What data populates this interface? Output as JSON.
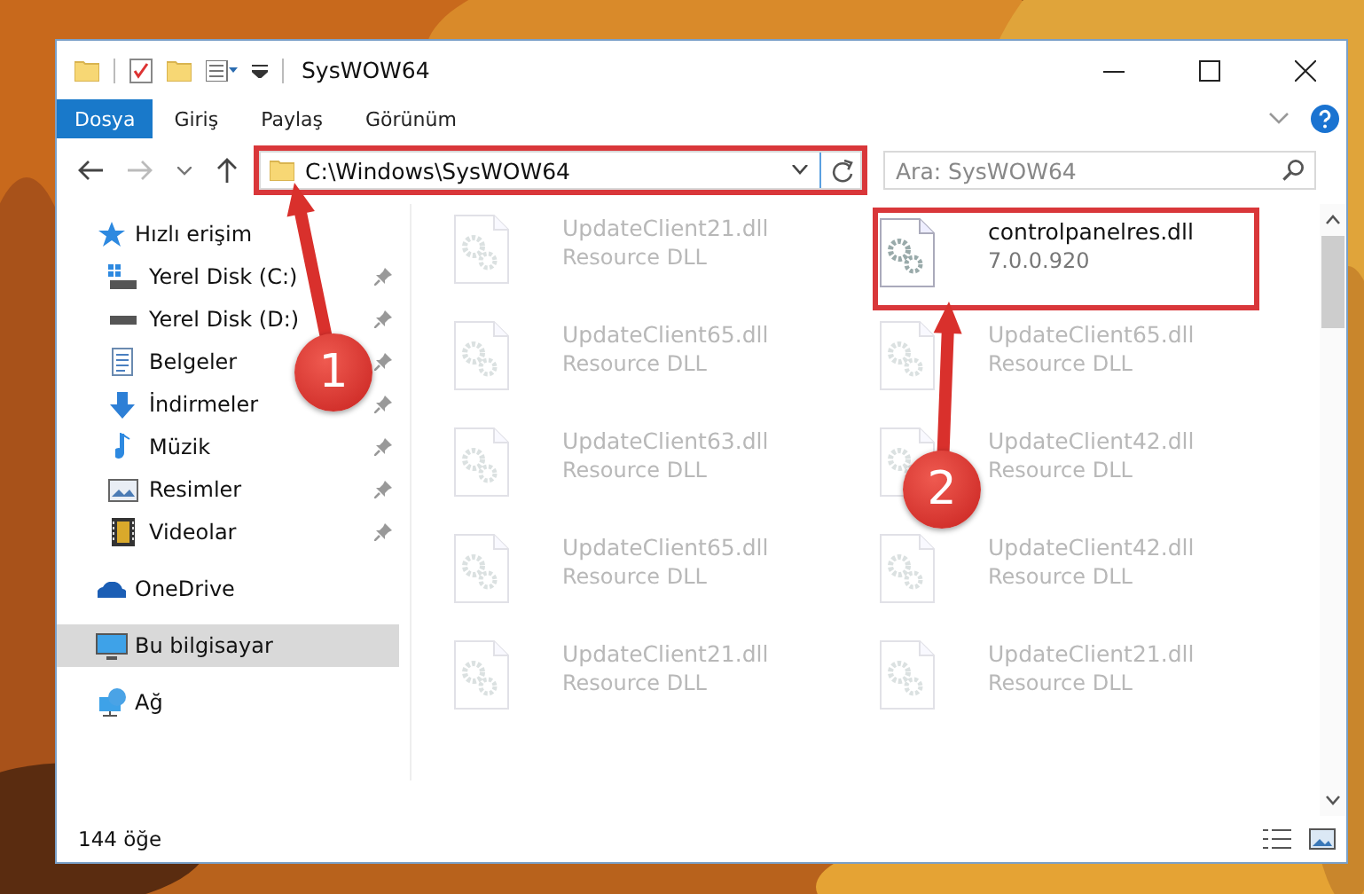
{
  "window": {
    "title": "SysWOW64"
  },
  "ribbon_tabs": [
    {
      "label": "Dosya",
      "selected": true
    },
    {
      "label": "Giriş",
      "selected": false
    },
    {
      "label": "Paylaş",
      "selected": false
    },
    {
      "label": "Görünüm",
      "selected": false
    }
  ],
  "address": {
    "value": "C:\\Windows\\SysWOW64",
    "highlighted": true
  },
  "search": {
    "placeholder": "Ara: SysWOW64"
  },
  "sidebar": {
    "items": [
      {
        "label": "Hızlı erişim",
        "kind": "star",
        "selected": false,
        "children": [
          {
            "label": "Yerel Disk (C:)",
            "kind": "systemdrive",
            "selected": false,
            "pinned": true
          },
          {
            "label": "Yerel Disk (D:)",
            "kind": "drive",
            "selected": false,
            "pinned": true
          },
          {
            "label": "Belgeler",
            "kind": "documents",
            "selected": false,
            "pinned": true
          },
          {
            "label": "İndirmeler",
            "kind": "downloads",
            "selected": false,
            "pinned": true
          },
          {
            "label": "Müzik",
            "kind": "music",
            "selected": false,
            "pinned": true
          },
          {
            "label": "Resimler",
            "kind": "pictures",
            "selected": false,
            "pinned": true
          },
          {
            "label": "Videolar",
            "kind": "videos",
            "selected": false,
            "pinned": true
          }
        ]
      },
      {
        "label": "OneDrive",
        "kind": "cloud",
        "selected": false
      },
      {
        "label": "Bu bilgisayar",
        "kind": "computer",
        "selected": true
      },
      {
        "label": "Ağ",
        "kind": "network",
        "selected": false
      }
    ]
  },
  "files": [
    {
      "name": "UpdateClient21.dll",
      "detail": "Resource DLL",
      "faded": true,
      "highlighted": false
    },
    {
      "name": "controlpanelres.dll",
      "detail": "7.0.0.920",
      "faded": false,
      "highlighted": true
    },
    {
      "name": "UpdateClient65.dll",
      "detail": "Resource DLL",
      "faded": true,
      "highlighted": false
    },
    {
      "name": "UpdateClient65.dll",
      "detail": "Resource DLL",
      "faded": true,
      "highlighted": false
    },
    {
      "name": "UpdateClient63.dll",
      "detail": "Resource DLL",
      "faded": true,
      "highlighted": false
    },
    {
      "name": "UpdateClient42.dll",
      "detail": "Resource DLL",
      "faded": true,
      "highlighted": false
    },
    {
      "name": "UpdateClient65.dll",
      "detail": "Resource DLL",
      "faded": true,
      "highlighted": false
    },
    {
      "name": "UpdateClient42.dll",
      "detail": "Resource DLL",
      "faded": true,
      "highlighted": false
    },
    {
      "name": "UpdateClient21.dll",
      "detail": "Resource DLL",
      "faded": true,
      "highlighted": false
    },
    {
      "name": "UpdateClient21.dll",
      "detail": "Resource DLL",
      "faded": true,
      "highlighted": false
    }
  ],
  "status_bar": {
    "count": "144 öğe"
  },
  "callouts": [
    {
      "label": "1"
    },
    {
      "label": "2"
    }
  ]
}
